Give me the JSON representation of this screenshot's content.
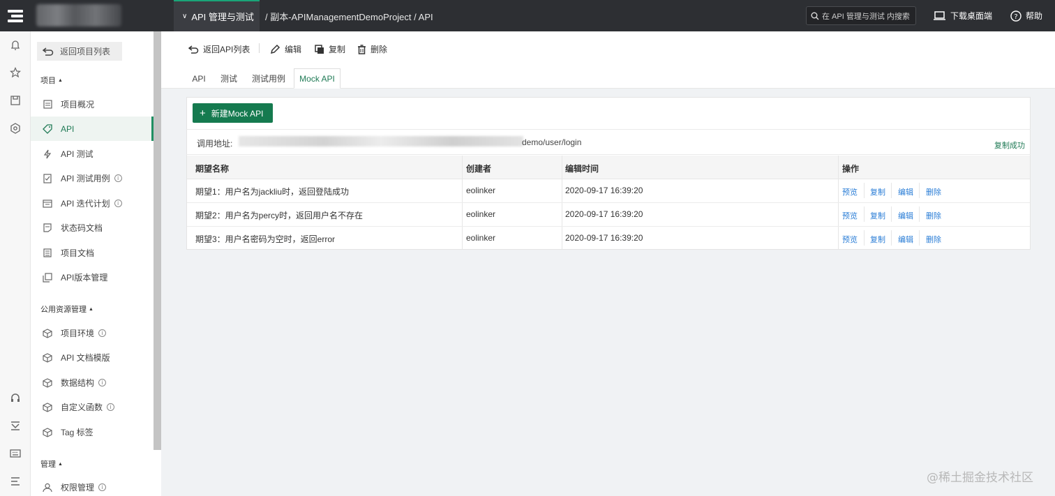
{
  "topbar": {
    "project_menu": "API 管理与测试",
    "breadcrumb": "/ 副本-APIManagementDemoProject / API",
    "search_placeholder": "在 API 管理与测试 内搜索",
    "download": "下载桌面端",
    "help": "帮助"
  },
  "sidebar": {
    "back": "返回项目列表",
    "section_project": "项目",
    "section_public": "公用资源管理",
    "section_manage": "管理",
    "items": [
      {
        "label": "项目概况"
      },
      {
        "label": "API"
      },
      {
        "label": "API 测试"
      },
      {
        "label": "API 测试用例"
      },
      {
        "label": "API 迭代计划"
      },
      {
        "label": "状态码文档"
      },
      {
        "label": "项目文档"
      },
      {
        "label": "API版本管理"
      }
    ],
    "public_items": [
      {
        "label": "项目环境"
      },
      {
        "label": "API 文档模版"
      },
      {
        "label": "数据结构"
      },
      {
        "label": "自定义函数"
      },
      {
        "label": "Tag 标签"
      }
    ],
    "manage_items": [
      {
        "label": "权限管理"
      }
    ],
    "info_glyph": "i"
  },
  "actions": {
    "back_list": "返回API列表",
    "edit": "编辑",
    "copy": "复制",
    "delete": "删除"
  },
  "tabs": [
    "API",
    "测试",
    "测试用例",
    "Mock API"
  ],
  "mock": {
    "new_button": "新建Mock API",
    "address_label": "调用地址:",
    "address_path": "demo/user/login",
    "copy_success": "复制成功",
    "columns": [
      "期望名称",
      "创建者",
      "编辑时间",
      "操作"
    ],
    "rows": [
      {
        "name": "期望1：用户名为jackliu时，返回登陆成功",
        "creator": "eolinker",
        "time": "2020-09-17 16:39:20"
      },
      {
        "name": "期望2：用户名为percy时，返回用户名不存在",
        "creator": "eolinker",
        "time": "2020-09-17 16:39:20"
      },
      {
        "name": "期望3：用户名密码为空时，返回error",
        "creator": "eolinker",
        "time": "2020-09-17 16:39:20"
      }
    ],
    "ops": [
      "预览",
      "复制",
      "编辑",
      "删除"
    ]
  },
  "watermark": "@稀土掘金技术社区",
  "colors": {
    "accent": "#1f7a55",
    "primary_button": "#157a4f",
    "link": "#2a7dd6",
    "topbar": "#2d2f33"
  }
}
